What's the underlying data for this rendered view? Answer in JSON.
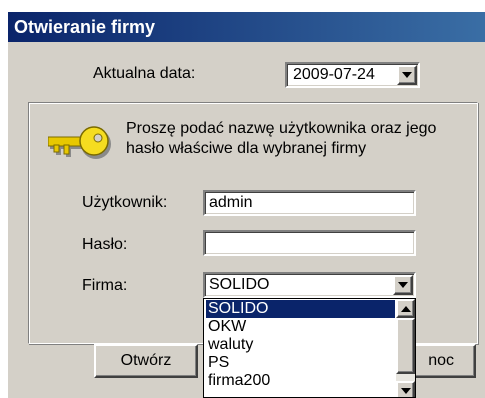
{
  "window": {
    "title": "Otwieranie firmy"
  },
  "date": {
    "label": "Aktualna data:",
    "value": "2009-07-24"
  },
  "info": {
    "line1": "Proszę podać nazwę użytkownika oraz jego",
    "line2": "hasło właściwe dla wybranej firmy"
  },
  "user": {
    "label": "Użytkownik:",
    "value": "admin"
  },
  "password": {
    "label": "Hasło:",
    "value": ""
  },
  "company": {
    "label": "Firma:",
    "value": "SOLIDO",
    "options": [
      "SOLIDO",
      "OKW",
      "waluty",
      "PS",
      "firma200"
    ]
  },
  "buttons": {
    "open": "Otwórz",
    "help_partial": "noc"
  }
}
